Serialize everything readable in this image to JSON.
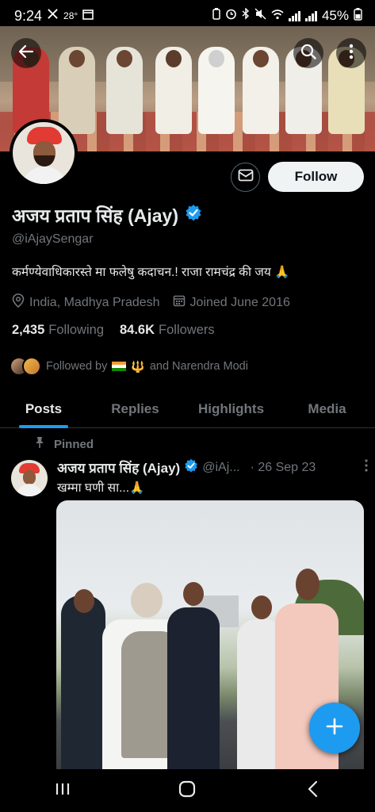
{
  "status_bar": {
    "time": "9:24",
    "temperature": "28°",
    "battery": "45%"
  },
  "profile": {
    "display_name": "अजय प्रताप सिंह (Ajay)",
    "handle": "@iAjaySengar",
    "bio": "कर्मण्येवाधिकारस्ते मा फलेषु कदाचन.!  राजा रामचंद्र की जय 🙏",
    "location": "India, Madhya Pradesh",
    "joined": "Joined June 2016",
    "following_count": "2,435",
    "following_label": "Following",
    "followers_count": "84.6K",
    "followers_label": "Followers",
    "followed_by_prefix": "Followed by",
    "followed_by_suffix": "and Narendra Modi",
    "follow_label": "Follow"
  },
  "tabs": [
    {
      "label": "Posts",
      "active": true
    },
    {
      "label": "Replies",
      "active": false
    },
    {
      "label": "Highlights",
      "active": false
    },
    {
      "label": "Media",
      "active": false
    }
  ],
  "pinned_post": {
    "pinned_label": "Pinned",
    "author_name": "अजय प्रताप सिंह (Ajay)",
    "author_handle": "@iAj...",
    "date": "· 26 Sep 23",
    "text": "खम्मा घणी सा...🙏"
  },
  "colors": {
    "accent": "#1d9bf0",
    "background": "#000000",
    "secondary_text": "#71767b"
  },
  "icons": [
    "back-arrow-icon",
    "search-icon",
    "more-vertical-icon",
    "mail-icon",
    "verified-badge-icon",
    "location-pin-icon",
    "calendar-icon",
    "pin-icon",
    "compose-plus-icon",
    "recents-icon",
    "home-icon",
    "back-chevron-icon"
  ]
}
